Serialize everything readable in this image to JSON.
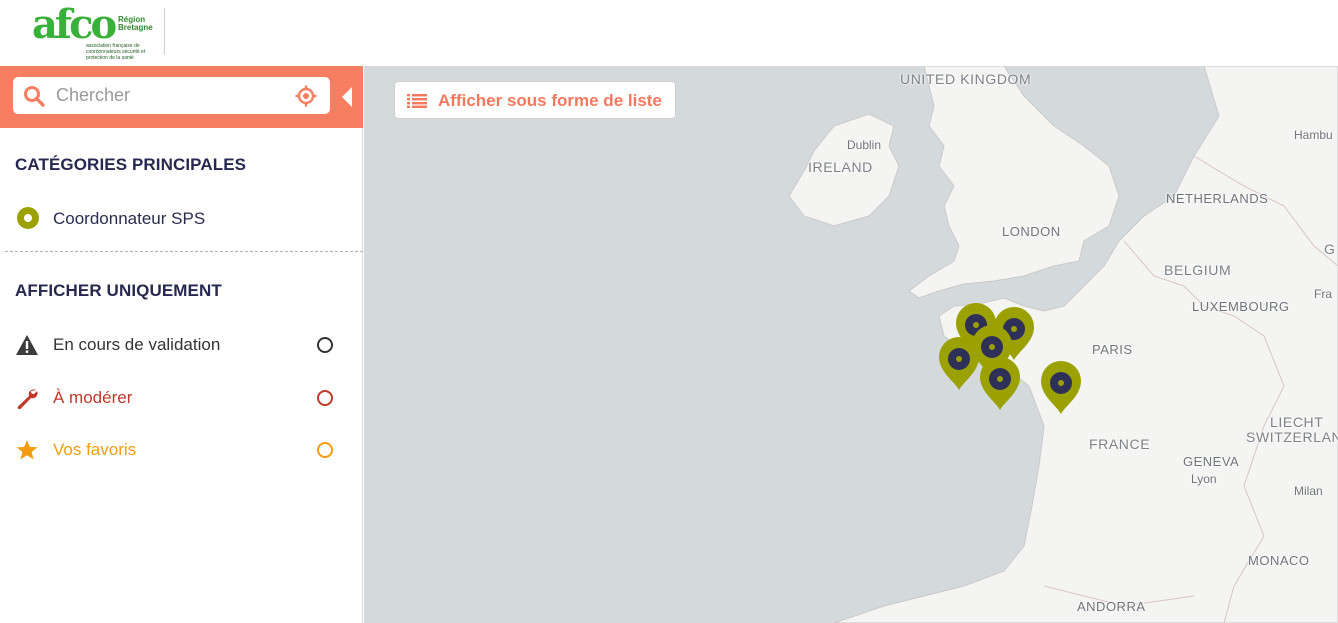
{
  "header": {
    "logo": {
      "brand": "afco",
      "region": "Région Bretagne",
      "subtitle": "association française de coordonnateurs sécurité et protection de la santé"
    }
  },
  "search": {
    "placeholder": "Chercher",
    "value": ""
  },
  "sidebar": {
    "categories_title": "CATÉGORIES PRINCIPALES",
    "categories": [
      {
        "label": "Coordonnateur SPS",
        "color": "#9aa100"
      }
    ],
    "filters_title": "AFFICHER UNIQUEMENT",
    "filters": [
      {
        "label": "En cours de validation",
        "icon": "warning-icon",
        "color": "#333333",
        "checked": false
      },
      {
        "label": "À modérer",
        "icon": "wrench-icon",
        "color": "#c0392b",
        "checked": false
      },
      {
        "label": "Vos favoris",
        "icon": "star-icon",
        "color": "#f39c12",
        "checked": false
      }
    ]
  },
  "map": {
    "list_button_label": "Afficher sous forme de liste",
    "labels": {
      "uk": "UNITED KINGDOM",
      "ireland": "IRELAND",
      "dublin": "Dublin",
      "london": "LONDON",
      "netherlands": "NETHERLANDS",
      "belgium": "BELGIUM",
      "luxembourg": "LUXEMBOURG",
      "paris": "PARIS",
      "france": "FRANCE",
      "geneva": "GENEVA",
      "lyon": "Lyon",
      "switzerland": "SWITZERLAN",
      "liechtenstein": "LIECHT",
      "milan": "Milan",
      "monaco": "MONACO",
      "andorra": "ANDORRA",
      "hamburg": "Hambu",
      "frankfurt": "Fra",
      "germany_g": "G"
    },
    "marker_color": "#9aa100",
    "marker_dot_color": "#2e3058",
    "marker_count": 6
  }
}
